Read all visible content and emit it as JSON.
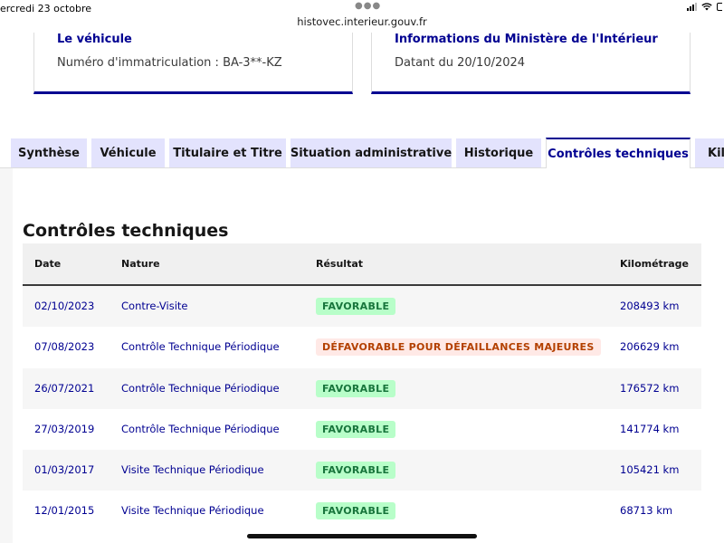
{
  "status_bar": {
    "date": "ercredi 23 octobre",
    "url": "histovec.interieur.gouv.fr"
  },
  "cards": {
    "vehicle": {
      "title": "Le véhicule",
      "text": "Numéro d'immatriculation : BA-3**-KZ"
    },
    "info": {
      "title": "Informations du Ministère de l'Intérieur",
      "text": "Datant du 20/10/2024"
    }
  },
  "tabs": [
    {
      "label": "Synthèse"
    },
    {
      "label": "Véhicule"
    },
    {
      "label": "Titulaire et Titre"
    },
    {
      "label": "Situation administrative"
    },
    {
      "label": "Historique"
    },
    {
      "label": "Contrôles techniques"
    },
    {
      "label": "Kilo"
    }
  ],
  "active_tab": "Contrôles techniques",
  "section": {
    "title": "Contrôles techniques"
  },
  "table": {
    "headers": {
      "date": "Date",
      "nature": "Nature",
      "result": "Résultat",
      "km": "Kilométrage"
    },
    "rows": [
      {
        "date": "02/10/2023",
        "nature": "Contre-Visite",
        "result": "FAVORABLE",
        "km": "208493 km"
      },
      {
        "date": "07/08/2023",
        "nature": "Contrôle Technique Périodique",
        "result": "DÉFAVORABLE POUR DÉFAILLANCES MAJEURES",
        "km": "206629 km"
      },
      {
        "date": "26/07/2021",
        "nature": "Contrôle Technique Périodique",
        "result": "FAVORABLE",
        "km": "176572 km"
      },
      {
        "date": "27/03/2019",
        "nature": "Contrôle Technique Périodique",
        "result": "FAVORABLE",
        "km": "141774 km"
      },
      {
        "date": "01/03/2017",
        "nature": "Visite Technique Périodique",
        "result": "FAVORABLE",
        "km": "105421 km"
      },
      {
        "date": "12/01/2015",
        "nature": "Visite Technique Périodique",
        "result": "FAVORABLE",
        "km": "68713 km"
      }
    ]
  },
  "colors": {
    "primary": "#000091",
    "tab_inactive": "#e3e3fd",
    "success_bg": "#b8fec9",
    "success_text": "#18753c",
    "error_bg": "#ffe9e6",
    "error_text": "#b34000"
  },
  "icons": [
    "signal-icon",
    "wifi-icon",
    "battery-icon",
    "tab-overview-dots-icon"
  ]
}
